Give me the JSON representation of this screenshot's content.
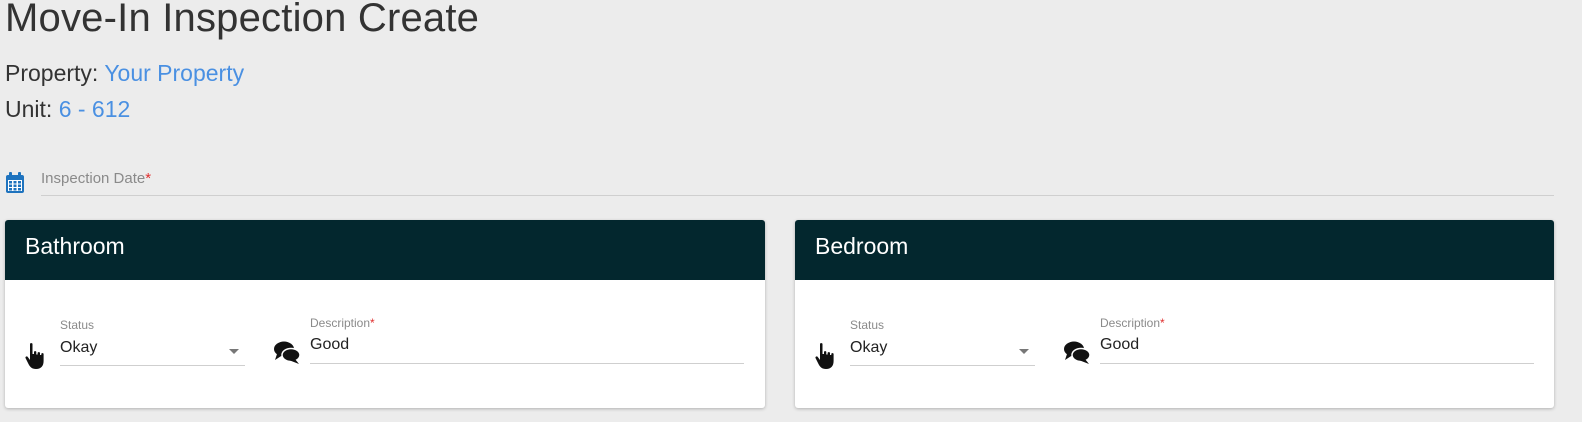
{
  "page": {
    "title": "Move-In Inspection Create",
    "property_label": "Property:",
    "property_value": "Your Property",
    "unit_label": "Unit:",
    "unit_value": "6 - 612"
  },
  "inspection_date": {
    "label": "Inspection Date",
    "required_mark": "*",
    "value": ""
  },
  "rooms": [
    {
      "name": "Bathroom",
      "status_label": "Status",
      "status_value": "Okay",
      "description_label": "Description",
      "description_required": "*",
      "description_value": "Good"
    },
    {
      "name": "Bedroom",
      "status_label": "Status",
      "status_value": "Okay",
      "description_label": "Description",
      "description_required": "*",
      "description_value": "Good"
    }
  ],
  "icons": {
    "date": "calendar-icon",
    "status": "pointing-hand-icon",
    "description": "speech-bubbles-icon"
  },
  "colors": {
    "background": "#ececec",
    "link": "#4a90e2",
    "card_header": "#03272e",
    "calendar_icon": "#1e73be",
    "required": "#e0302f"
  }
}
